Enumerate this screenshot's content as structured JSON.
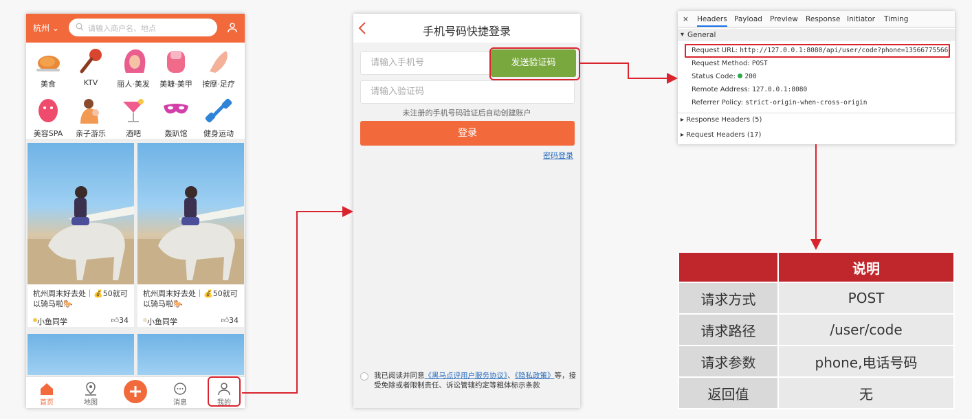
{
  "phone1": {
    "city": "杭州",
    "search_placeholder": "请输入商户名、地点",
    "categories": [
      {
        "label": "美食",
        "icon": "chicken-icon"
      },
      {
        "label": "KTV",
        "icon": "microphone-icon"
      },
      {
        "label": "丽人·美发",
        "icon": "hair-icon"
      },
      {
        "label": "美睫·美甲",
        "icon": "nail-icon"
      },
      {
        "label": "按摩·足疗",
        "icon": "foot-icon"
      },
      {
        "label": "美容SPA",
        "icon": "face-mask-icon"
      },
      {
        "label": "亲子游乐",
        "icon": "family-icon"
      },
      {
        "label": "酒吧",
        "icon": "cocktail-icon"
      },
      {
        "label": "轰趴馆",
        "icon": "party-mask-icon"
      },
      {
        "label": "健身运动",
        "icon": "dumbbell-icon"
      }
    ],
    "cards": [
      {
        "title": "杭州周末好去处｜💰50就可以骑马啦🐎",
        "user": "小鱼同学",
        "likes": "34"
      },
      {
        "title": "杭州周末好去处｜💰50就可以骑马啦🐎",
        "user": "小鱼同学",
        "likes": "34"
      }
    ],
    "tabs": [
      {
        "label": "首页",
        "icon": "home-icon"
      },
      {
        "label": "地图",
        "icon": "map-pin-icon"
      },
      {
        "label": "",
        "icon": "plus-icon"
      },
      {
        "label": "消息",
        "icon": "message-icon"
      },
      {
        "label": "我的",
        "icon": "user-icon"
      }
    ]
  },
  "phone2": {
    "title": "手机号码快捷登录",
    "phone_placeholder": "请输入手机号",
    "send_code_label": "发送验证码",
    "code_placeholder": "请输入验证码",
    "hint": "未注册的手机号码验证后自动创建账户",
    "login_label": "登录",
    "password_login": "密码登录",
    "agree_prefix": "我已阅读并同意",
    "agree_link1": "《黑马点评用户服务协议》",
    "agree_sep": "、",
    "agree_link2": "《隐私政策》",
    "agree_suffix": "等，接受免除或者限制责任、诉讼管辖约定等粗体标示条款"
  },
  "devtools": {
    "close": "×",
    "tabs": [
      "Headers",
      "Payload",
      "Preview",
      "Response",
      "Initiator",
      "Timing"
    ],
    "general_label": "General",
    "rows": [
      {
        "key": "Request URL:",
        "value": "http://127.0.0.1:8080/api/user/code?phone=13566775566"
      },
      {
        "key": "Request Method:",
        "value": "POST"
      },
      {
        "key": "Status Code:",
        "value": "200"
      },
      {
        "key": "Remote Address:",
        "value": "127.0.0.1:8080"
      },
      {
        "key": "Referrer Policy:",
        "value": "strict-origin-when-cross-origin"
      }
    ],
    "response_headers": "Response Headers (5)",
    "request_headers": "Request Headers (17)"
  },
  "info_table": {
    "header": [
      "",
      "说明"
    ],
    "rows": [
      [
        "请求方式",
        "POST"
      ],
      [
        "请求路径",
        "/user/code"
      ],
      [
        "请求参数",
        "phone,电话号码"
      ],
      [
        "返回值",
        "无"
      ]
    ]
  },
  "colors": {
    "brand_orange": "#f26a3b",
    "send_green": "#79a83e",
    "annotation_red": "#d9232d",
    "table_header_red": "#c0272d"
  }
}
